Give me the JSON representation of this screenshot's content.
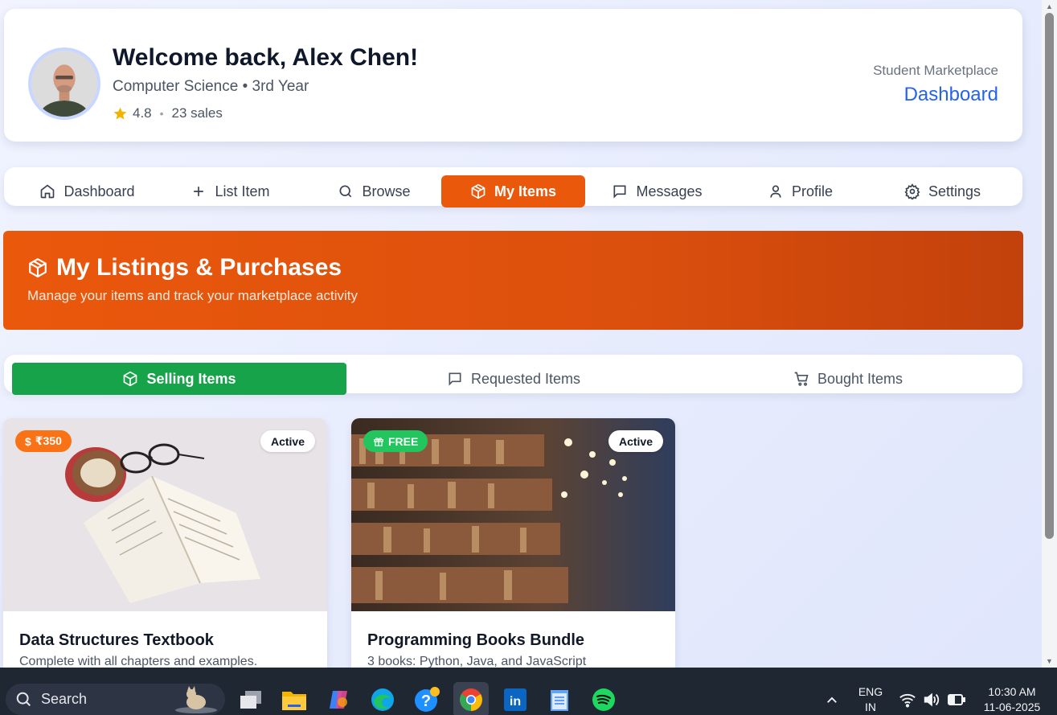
{
  "header": {
    "welcome": "Welcome back, Alex Chen!",
    "department": "Computer Science • 3rd Year",
    "rating": "4.8",
    "rating_separator": "•",
    "sales": "23 sales",
    "brand_subtitle": "Student Marketplace",
    "brand_title": "Dashboard"
  },
  "nav": {
    "items": [
      {
        "label": "Dashboard",
        "icon": "home-icon"
      },
      {
        "label": "List Item",
        "icon": "plus-icon"
      },
      {
        "label": "Browse",
        "icon": "search-icon"
      },
      {
        "label": "My Items",
        "icon": "package-icon",
        "active": true
      },
      {
        "label": "Messages",
        "icon": "message-icon"
      },
      {
        "label": "Profile",
        "icon": "user-icon"
      },
      {
        "label": "Settings",
        "icon": "gear-icon"
      }
    ]
  },
  "banner": {
    "title": "My Listings & Purchases",
    "subtitle": "Manage your items and track your marketplace activity"
  },
  "subtabs": [
    {
      "label": "Selling Items",
      "icon": "package-icon",
      "active": true
    },
    {
      "label": "Requested Items",
      "icon": "message-icon"
    },
    {
      "label": "Bought Items",
      "icon": "cart-icon"
    }
  ],
  "cards": [
    {
      "price": "₹350",
      "price_icon": "dollar-icon",
      "price_color": "#f97316",
      "status": "Active",
      "title": "Data Structures Textbook",
      "description": "Complete with all chapters and examples."
    },
    {
      "price": "FREE",
      "price_icon": "gift-icon",
      "price_color": "#22c55e",
      "status": "Active",
      "title": "Programming Books Bundle",
      "description": "3 books: Python, Java, and JavaScript"
    }
  ],
  "colors": {
    "accent_orange": "#ea580c",
    "accent_green": "#16a34a",
    "brand_blue": "#2563eb"
  },
  "taskbar": {
    "search_placeholder": "Search",
    "language": "ENG",
    "region": "IN",
    "time": "10:30 AM",
    "date": "11-06-2025"
  }
}
